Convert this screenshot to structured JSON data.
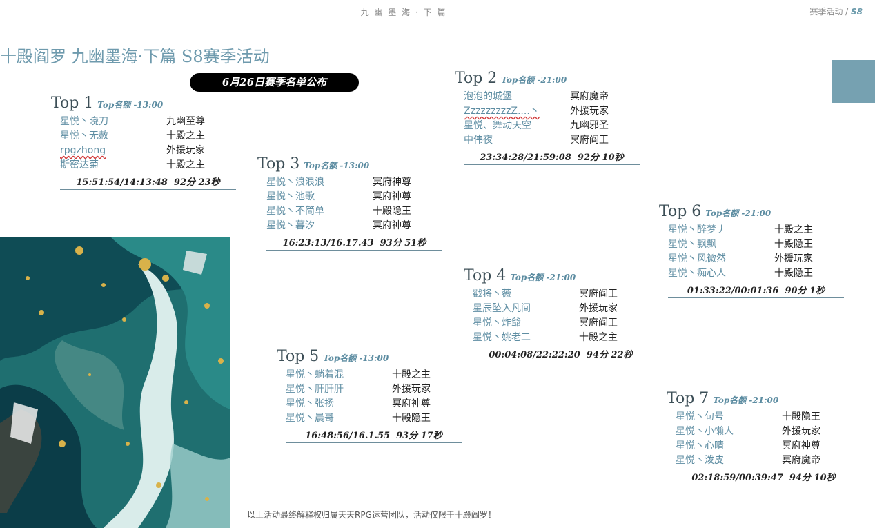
{
  "header": {
    "center": "九 幽 墨 海 · 下 篇",
    "right_prefix": "赛季活动 / ",
    "right_season": "S8"
  },
  "title": "十殿阎罗  九幽墨海·下篇 S8赛季活动",
  "badge": "6月26日赛季名单公布",
  "footer": "以上活动最终解释权归属天天RPG运营团队，活动仅限于十殿阎罗！",
  "colors": {
    "accent": "#6e9aad",
    "swatch": "#76a1b1",
    "badge_bg": "#000000"
  },
  "groups": [
    {
      "top": "Top  1",
      "quota": "Top名额 -13:00",
      "rows": [
        {
          "name": "星悦丶晓刀",
          "server": "九幽至尊"
        },
        {
          "name": "星悦丶无赦",
          "server": "十殿之主"
        },
        {
          "name": "rpgzhong",
          "server": "外援玩家"
        },
        {
          "name": "斯密达菊",
          "server": "十殿之主"
        }
      ],
      "time": "15:51:54/14:13:48",
      "score": "92分 23秒"
    },
    {
      "top": "Top  2",
      "quota": "Top名额 -21:00",
      "rows": [
        {
          "name": "泡泡的城堡",
          "server": "冥府魔帝"
        },
        {
          "name": "ZzzzzzzzzZ....丶",
          "server": "外援玩家"
        },
        {
          "name": "星悦、舞动天空",
          "server": "九幽邪圣"
        },
        {
          "name": "中伟夜",
          "server": "冥府阎王"
        }
      ],
      "time": "23:34:28/21:59:08",
      "score": "92分 10秒"
    },
    {
      "top": "Top  3",
      "quota": "Top名额 -13:00",
      "rows": [
        {
          "name": "星悦丶浪浪浪",
          "server": "冥府神尊"
        },
        {
          "name": "星悦丶池歌",
          "server": "冥府神尊"
        },
        {
          "name": "星悦丶不简单",
          "server": "十殿隐王"
        },
        {
          "name": "星悦丶暮汐",
          "server": "冥府神尊"
        }
      ],
      "time": "16:23:13/16.17.43",
      "score": "93分 51秒"
    },
    {
      "top": "Top  4",
      "quota": "Top名额 -21:00",
      "rows": [
        {
          "name": "戳将丶薇",
          "server": "冥府阎王"
        },
        {
          "name": "星辰坠入凡间",
          "server": "外援玩家"
        },
        {
          "name": "星悦丶炸爺",
          "server": "冥府阎王"
        },
        {
          "name": "星悦丶姚老二",
          "server": "十殿之主"
        }
      ],
      "time": "00:04:08/22:22:20",
      "score": "94分 22秒"
    },
    {
      "top": "Top  5",
      "quota": "Top名额 -13:00",
      "rows": [
        {
          "name": "星悦丶躺着混",
          "server": "十殿之主"
        },
        {
          "name": "星悦丶肝肝肝",
          "server": "外援玩家"
        },
        {
          "name": "星悦丶张扬",
          "server": "冥府神尊"
        },
        {
          "name": "星悦丶晨哥",
          "server": "十殿隐王"
        }
      ],
      "time": "16:48:56/16.1.55",
      "score": "93分 17秒"
    },
    {
      "top": "Top  6",
      "quota": "Top名额 -21:00",
      "rows": [
        {
          "name": "星悦丶醉梦丿",
          "server": "十殿之主"
        },
        {
          "name": "星悦丶飘飘",
          "server": "十殿隐王"
        },
        {
          "name": "星悦丶风微然",
          "server": "外援玩家"
        },
        {
          "name": "星悦丶痴心人",
          "server": "十殿隐王"
        }
      ],
      "time": "01:33:22/00:01:36",
      "score": "90分 1秒"
    },
    {
      "top": "Top  7",
      "quota": "Top名额 -21:00",
      "rows": [
        {
          "name": "星悦丶句号",
          "server": "十殿隐王"
        },
        {
          "name": "星悦丶小懒人",
          "server": "外援玩家"
        },
        {
          "name": "星悦丶心晴",
          "server": "冥府神尊"
        },
        {
          "name": "星悦丶泼皮",
          "server": "冥府魔帝"
        }
      ],
      "time": "02:18:59/00:39:47",
      "score": "94分 10秒"
    }
  ]
}
